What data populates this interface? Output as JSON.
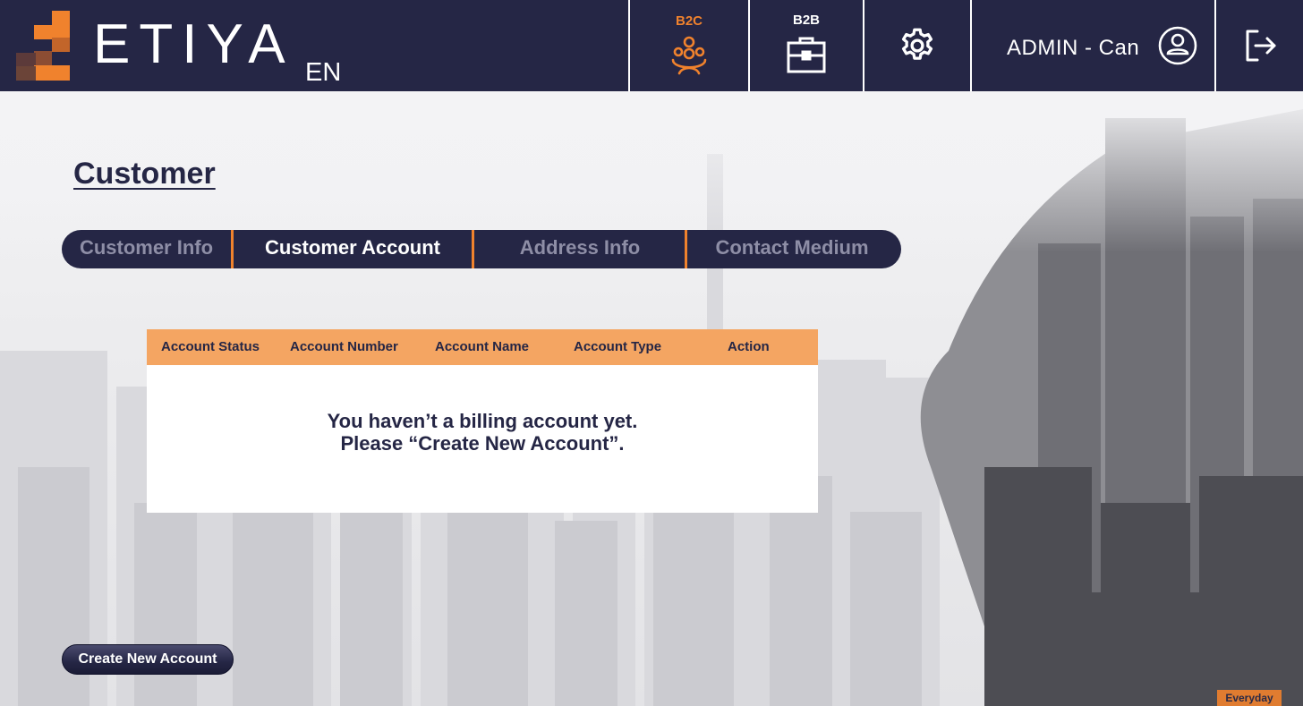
{
  "brand": {
    "name": "ETIYA",
    "language": "EN"
  },
  "colors": {
    "navy": "#252645",
    "orange": "#f0822d",
    "table_header": "#f4a562"
  },
  "nav": {
    "b2c": {
      "label": "B2C",
      "icon": "people-group-icon"
    },
    "b2b": {
      "label": "B2B",
      "icon": "briefcase-icon"
    },
    "settings_icon": "gear-icon",
    "user": {
      "name": "ADMIN - Can",
      "icon": "user-circle-icon"
    },
    "logout_icon": "logout-icon"
  },
  "page": {
    "title": "Customer"
  },
  "tabs": [
    {
      "label": "Customer Info",
      "active": false
    },
    {
      "label": "Customer Account",
      "active": true
    },
    {
      "label": "Address Info",
      "active": false
    },
    {
      "label": "Contact Medium",
      "active": false
    }
  ],
  "table": {
    "columns": [
      "Account Status",
      "Account Number",
      "Account Name",
      "Account Type",
      "Action"
    ],
    "empty_line1": "You haven’t a billing account yet.",
    "empty_line2": "Please “Create New Account”."
  },
  "actions": {
    "create_label": "Create New Account"
  },
  "footer": {
    "tag": "Everyday"
  }
}
